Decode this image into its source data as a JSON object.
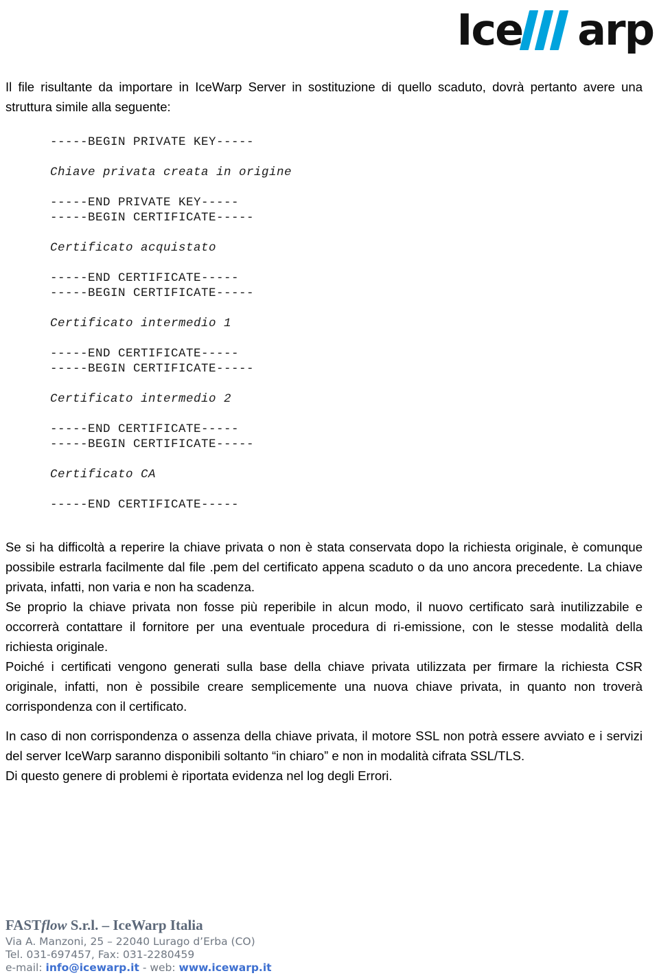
{
  "logo": {
    "part1": "Ice",
    "part2": "W",
    "part3": "arp",
    "accent_color": "#00a3dd",
    "text_color": "#111111"
  },
  "intro": {
    "paragraph": "Il file risultante da importare in IceWarp Server in sostituzione di quello scaduto, dovrà pertanto avere una struttura simile alla seguente:"
  },
  "certificate_block": {
    "lines": [
      "-----BEGIN PRIVATE KEY-----",
      "",
      "Chiave privata creata in origine",
      "",
      "-----END PRIVATE KEY-----",
      "-----BEGIN CERTIFICATE-----",
      "",
      "Certificato acquistato",
      "",
      "-----END CERTIFICATE-----",
      "-----BEGIN CERTIFICATE-----",
      "",
      "Certificato intermedio 1",
      "",
      "-----END CERTIFICATE-----",
      "-----BEGIN CERTIFICATE-----",
      "",
      "Certificato intermedio 2",
      "",
      "-----END CERTIFICATE-----",
      "-----BEGIN CERTIFICATE-----",
      "",
      "Certificato CA",
      "",
      "-----END CERTIFICATE-----"
    ],
    "italic_indices": [
      2,
      7,
      12,
      17,
      22
    ]
  },
  "body": {
    "p1": "Se si ha difficoltà a reperire la chiave privata o non è stata conservata dopo la richiesta originale, è comunque possibile estrarla facilmente dal file .pem del certificato appena scaduto o da uno ancora precedente. La chiave privata, infatti, non varia e non ha scadenza.",
    "p2": "Se proprio la chiave privata non fosse più reperibile in alcun modo, il nuovo certificato sarà inutilizzabile e occorrerà contattare il fornitore per una eventuale procedura di ri-emissione, con le stesse modalità della richiesta originale.",
    "p3": "Poiché i certificati vengono generati sulla base della chiave privata utilizzata per firmare la richiesta CSR originale, infatti, non è possibile creare semplicemente una nuova chiave privata, in quanto non troverà corrispondenza con il certificato.",
    "p4": "In caso di non corrispondenza o assenza della chiave privata, il motore SSL non potrà essere avviato e i servizi del server IceWarp saranno disponibili soltanto “in chiaro” e non in modalità cifrata SSL/TLS.",
    "p5": "Di questo genere di problemi è riportata evidenza nel log degli Errori."
  },
  "footer": {
    "title_prefix": "FAST",
    "title_italic": "flow",
    "title_suffix": " S.r.l. – IceWarp Italia",
    "address": "Via A. Manzoni, 25 – 22040 Lurago d’Erba (CO)",
    "phone": "Tel. 031-697457, Fax: 031-2280459",
    "email_label": "e-mail: ",
    "email": "info@icewarp.it",
    "separator": " - ",
    "web_label": "web: ",
    "web": "www.icewarp.it",
    "link_color": "#3d6fd0",
    "text_color": "#6f7782",
    "title_color": "#5c6879"
  }
}
